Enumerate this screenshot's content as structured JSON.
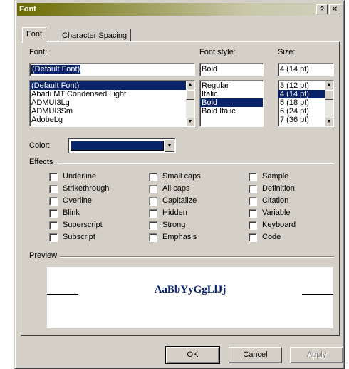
{
  "window": {
    "title": "Font",
    "help_btn": "?",
    "close_btn": "✕"
  },
  "tabs": [
    {
      "label": "Font"
    },
    {
      "label": "Character Spacing"
    }
  ],
  "font": {
    "label": "Font:",
    "value": "(Default Font)",
    "items": [
      "(Default Font)",
      "Abadi MT Condensed Light",
      "ADMUI3Lg",
      "ADMUI3Sm",
      "AdobeLg"
    ],
    "selected_index": 0
  },
  "style": {
    "label": "Font style:",
    "value": "Bold",
    "items": [
      "Regular",
      "Italic",
      "Bold",
      "Bold Italic"
    ],
    "selected_index": 2
  },
  "size": {
    "label": "Size:",
    "value": "4 (14 pt)",
    "items": [
      "3 (12 pt)",
      "4 (14 pt)",
      "5 (18 pt)",
      "6 (24 pt)",
      "7 (36 pt)"
    ],
    "selected_index": 1
  },
  "color": {
    "label": "Color:",
    "value": "#0a246a"
  },
  "effects": {
    "label": "Effects",
    "col1": [
      "Underline",
      "Strikethrough",
      "Overline",
      "Blink",
      "Superscript",
      "Subscript"
    ],
    "col2": [
      "Small caps",
      "All caps",
      "Capitalize",
      "Hidden",
      "Strong",
      "Emphasis"
    ],
    "col3": [
      "Sample",
      "Definition",
      "Citation",
      "Variable",
      "Keyboard",
      "Code"
    ]
  },
  "preview": {
    "label": "Preview",
    "text": "AaBbYyGgLlJj"
  },
  "buttons": {
    "ok": "OK",
    "cancel": "Cancel",
    "apply": "Apply"
  },
  "colors": {
    "selection": "#0a246a",
    "face": "#d4d0c8"
  }
}
